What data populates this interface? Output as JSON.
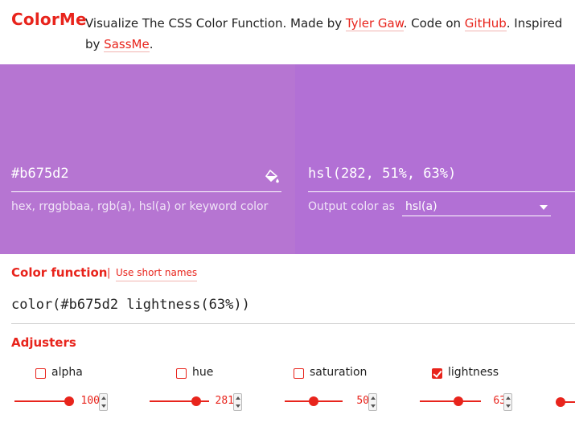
{
  "header": {
    "logo": "ColorMe",
    "tagline_prefix": "Visualize The CSS Color Function. Made by ",
    "author_link": "Tyler Gaw",
    "tagline_mid": ". Code on ",
    "github_link": "GitHub",
    "tagline_mid2": ". Inspired by ",
    "inspired_link": "SassMe",
    "tagline_suffix": "."
  },
  "input_panel": {
    "value": "#b675d2",
    "hint": "hex, rrggbbaa, rgb(a), hsl(a) or keyword color",
    "color": "#b675d2",
    "icon": "paint-bucket-icon"
  },
  "output_panel": {
    "value": "hsl(282, 51%, 63%)",
    "label": "Output color as",
    "format_selected": "hsl(a)",
    "color": "#b270d5"
  },
  "color_function": {
    "title": "Color function",
    "separator": "|",
    "short_names_link": "Use short names",
    "expression": "color(#b675d2 lightness(63%))"
  },
  "adjusters": {
    "title": "Adjusters",
    "items": [
      {
        "name": "alpha",
        "checked": false,
        "value": "100",
        "fraction": 1.0
      },
      {
        "name": "hue",
        "checked": false,
        "value": "281",
        "fraction": 0.78
      },
      {
        "name": "saturation",
        "checked": false,
        "value": "50",
        "fraction": 0.5
      },
      {
        "name": "lightness",
        "checked": true,
        "value": "63",
        "fraction": 0.63
      }
    ]
  },
  "colors": {
    "accent": "#e8241c"
  }
}
